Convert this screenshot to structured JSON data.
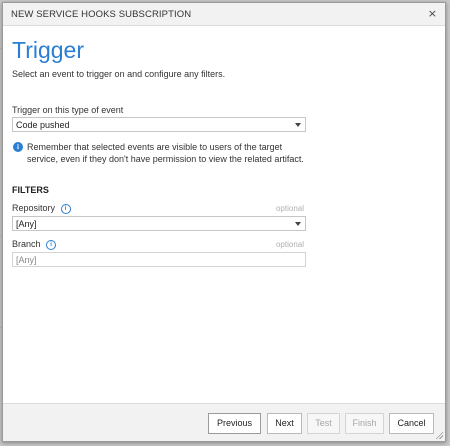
{
  "dialog": {
    "title": "NEW SERVICE HOOKS SUBSCRIPTION",
    "close_glyph": "×"
  },
  "page": {
    "heading": "Trigger",
    "subtitle": "Select an event to trigger on and configure any filters."
  },
  "event_type": {
    "label": "Trigger on this type of event",
    "selected": "Code pushed"
  },
  "notice": {
    "icon": "info-icon",
    "text": "Remember that selected events are visible to users of the target service, even if they don't have permission to view the related artifact."
  },
  "filters": {
    "section_title": "FILTERS",
    "repository": {
      "label": "Repository",
      "optional": "optional",
      "selected": "[Any]"
    },
    "branch": {
      "label": "Branch",
      "optional": "optional",
      "placeholder": "[Any]"
    }
  },
  "footer": {
    "previous": "Previous",
    "next": "Next",
    "test": "Test",
    "finish": "Finish",
    "cancel": "Cancel"
  },
  "colors": {
    "accent": "#2a7fd4",
    "disabled_text": "#a6a6a6"
  }
}
